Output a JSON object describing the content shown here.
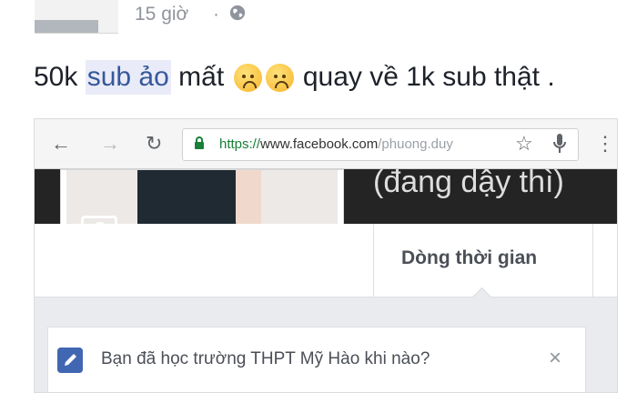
{
  "post": {
    "timestamp": "15 giờ",
    "separator": "·",
    "privacy_icon": "globe-icon",
    "text_part1": "50k",
    "text_highlight": "sub ảo",
    "text_part2": "mất",
    "emojis": [
      "disappointed-face-icon",
      "disappointed-face-icon"
    ],
    "text_part3": "quay về 1k sub thật ."
  },
  "browser": {
    "back_icon": "←",
    "forward_icon": "→",
    "reload_icon": "↻",
    "url_scheme": "https://",
    "url_host": "www.facebook.com",
    "url_path": "/phuong.duy",
    "star_icon": "☆",
    "menu_icon": "⋮"
  },
  "profile": {
    "cover_name": "(đang dậy thì)",
    "timeline_tab": "Dòng thời gian",
    "question": "Bạn đã học trường THPT Mỹ Hào khi nào?",
    "close": "×"
  },
  "colors": {
    "link": "#365899",
    "accent": "#4267b2",
    "secure_green": "#188038"
  }
}
